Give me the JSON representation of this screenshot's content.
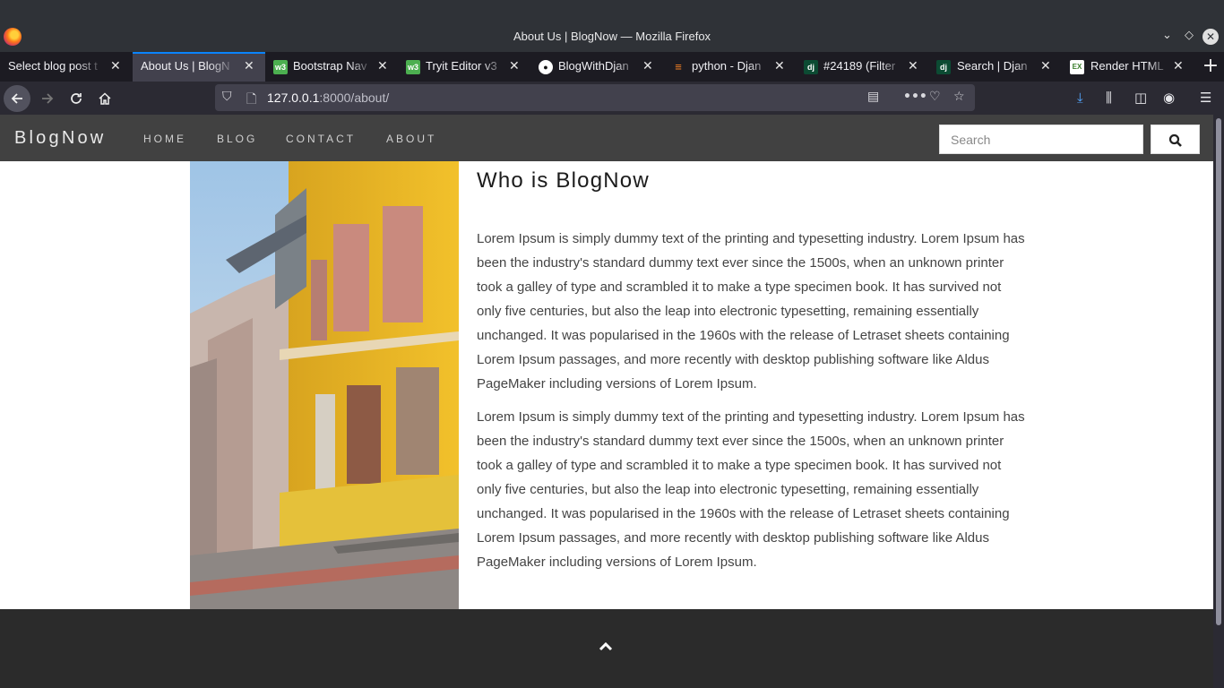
{
  "window": {
    "title": "About Us | BlogNow — Mozilla Firefox",
    "controls": {
      "minimize": "⌄",
      "maximize": "◇",
      "close": "✕"
    }
  },
  "tabs": [
    {
      "label": "Select blog post t",
      "favicon": ""
    },
    {
      "label": "About Us | BlogN",
      "favicon": ""
    },
    {
      "label": "Bootstrap Nav",
      "favicon": "w3"
    },
    {
      "label": "Tryit Editor v3",
      "favicon": "w3"
    },
    {
      "label": "BlogWithDjan",
      "favicon": "github"
    },
    {
      "label": "python - Djan",
      "favicon": "stackoverflow"
    },
    {
      "label": "#24189 (Filter",
      "favicon": "dj"
    },
    {
      "label": "Search | Djan",
      "favicon": "dj"
    },
    {
      "label": "Render HTML",
      "favicon": "ex"
    }
  ],
  "favicon_text": {
    "w3": "w3",
    "dj": "dj",
    "ex": "EX"
  },
  "toolbar": {
    "url_host": "127.0.0.1",
    "url_rest": ":8000/about/",
    "new_tab": "+"
  },
  "site": {
    "brand": "BlogNow",
    "menu": [
      "HOME",
      "BLOG",
      "CONTACT",
      "ABOUT"
    ],
    "search_placeholder": "Search"
  },
  "about": {
    "title": "Who is BlogNow",
    "paragraphs": [
      "Lorem Ipsum is simply dummy text of the printing and typesetting industry. Lorem Ipsum has been the industry's standard dummy text ever since the 1500s, when an unknown printer took a galley of type and scrambled it to make a type specimen book. It has survived not only five centuries, but also the leap into electronic typesetting, remaining essentially unchanged. It was popularised in the 1960s with the release of Letraset sheets containing Lorem Ipsum passages, and more recently with desktop publishing software like Aldus PageMaker including versions of Lorem Ipsum.",
      "Lorem Ipsum is simply dummy text of the printing and typesetting industry. Lorem Ipsum has been the industry's standard dummy text ever since the 1500s, when an unknown printer took a galley of type and scrambled it to make a type specimen book. It has survived not only five centuries, but also the leap into electronic typesetting, remaining essentially unchanged. It was popularised in the 1960s with the release of Letraset sheets containing Lorem Ipsum passages, and more recently with desktop publishing software like Aldus PageMaker including versions of Lorem Ipsum."
    ]
  },
  "colors": {
    "site_nav": "#414141",
    "footer": "#2b2b2b",
    "accent": "#0a84ff"
  }
}
